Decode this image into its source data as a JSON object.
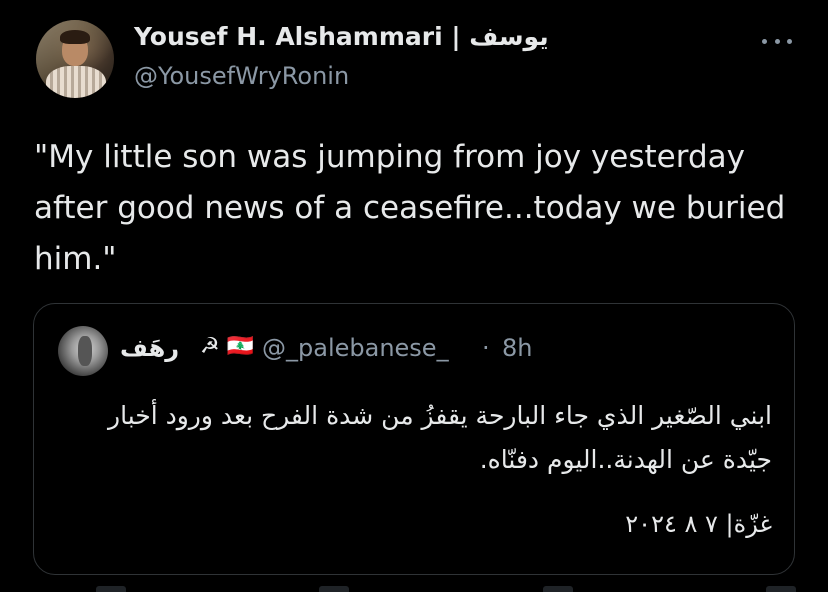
{
  "tweet": {
    "author": {
      "name": "Yousef H. Alshammari | يوسف",
      "handle": "@YousefWryRonin"
    },
    "text": "\"My little son was jumping from joy yesterday after good news of a ceasefire...today we buried him.\"",
    "more_icon": "more-horizontal-icon"
  },
  "quote": {
    "author": {
      "name": "رهَف",
      "icons": "☭ 🇱🇧",
      "handle": "@_palebanese_",
      "separator": "·",
      "time": "8h"
    },
    "text": "ابني الصّغير الذي جاء البارحة يقفزُ من شدة الفرح بعد ورود أخبار جيّدة عن الهدنة..اليوم دفنّاه.",
    "footer": "غزّة| ٧ ٨ ٢٠٢٤"
  },
  "colors": {
    "background": "#000000",
    "text_primary": "#e7e9ea",
    "text_secondary": "#8b98a5",
    "border": "#2f3336"
  }
}
